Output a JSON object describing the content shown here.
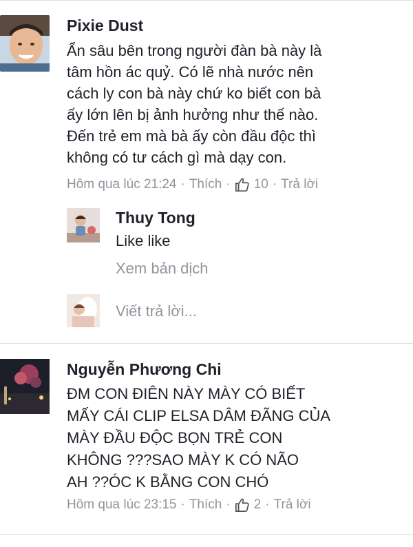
{
  "comments": [
    {
      "author": "Pixie Dust",
      "text_lines": [
        "Ẩn sâu bên trong người đàn bà này là",
        "tâm hồn ác quỷ. Có lẽ nhà nước nên",
        "cách ly con bà này chứ ko biết con bà",
        "ấy lớn lên bị ảnh hưởng như thế nào.",
        "Đến trẻ em mà bà ấy còn đầu độc thì",
        "không có tư cách gì mà dạy con."
      ],
      "timestamp": "Hôm qua lúc 21:24",
      "like_label": "Thích",
      "like_count": "10",
      "reply_label": "Trả lời"
    },
    {
      "author": "Nguyễn Phương Chi",
      "text_lines": [
        "ĐM CON ĐIÊN NÀY MÀY CÓ BIẾT",
        "MẤY CÁI CLIP ELSA DÂM ĐÃNG CỦA",
        "MÀY ĐẦU ĐỘC BỌN TRẺ CON",
        "KHÔNG ???SAO MÀY K CÓ NÃO",
        "AH ??ÓC K BẰNG CON CHÓ"
      ],
      "timestamp": "Hôm qua lúc 23:15",
      "like_label": "Thích",
      "like_count": "2",
      "reply_label": "Trả lời"
    }
  ],
  "reply": {
    "author": "Thuy Tong",
    "text": "Like like",
    "translate_label": "Xem bản dịch"
  },
  "reply_input": {
    "placeholder": "Viết trả lời..."
  },
  "colors": {
    "text": "#1d2129",
    "muted": "#90949c",
    "divider": "#dddfe2",
    "like_icon": "#90949c"
  },
  "icons": {
    "like": "thumbs-up-icon"
  }
}
